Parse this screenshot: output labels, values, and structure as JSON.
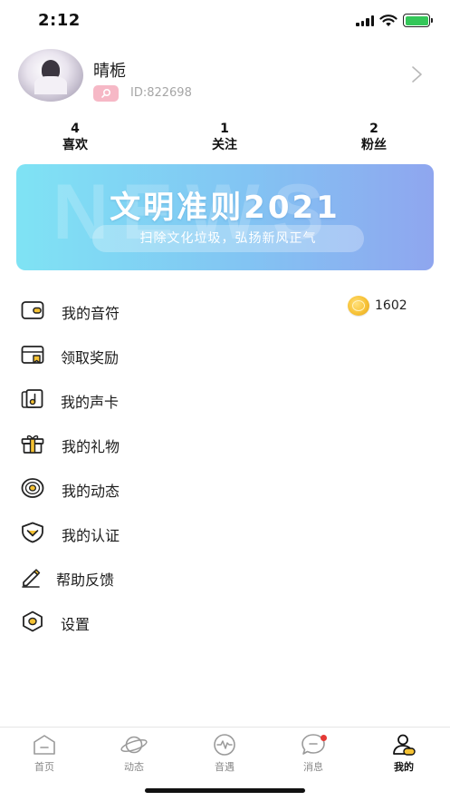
{
  "status_bar": {
    "time": "2:12"
  },
  "profile": {
    "name": "晴栀",
    "id_text": "ID:822698"
  },
  "stats": [
    {
      "count": "4",
      "label": "喜欢"
    },
    {
      "count": "1",
      "label": "关注"
    },
    {
      "count": "2",
      "label": "粉丝"
    }
  ],
  "banner": {
    "watermark": "NEWS",
    "title": "文明准则2021",
    "subtitle": "扫除文化垃圾，弘扬新风正气"
  },
  "menu": [
    {
      "label": "我的音符",
      "icon": "wallet-icon"
    },
    {
      "label": "领取奖励",
      "icon": "reward-card-icon"
    },
    {
      "label": "我的声卡",
      "icon": "sound-card-icon"
    },
    {
      "label": "我的礼物",
      "icon": "gift-icon"
    },
    {
      "label": "我的动态",
      "icon": "record-disc-icon"
    },
    {
      "label": "我的认证",
      "icon": "verified-shield-icon"
    },
    {
      "label": "帮助反馈",
      "icon": "pencil-icon"
    },
    {
      "label": "设置",
      "icon": "hexagon-settings-icon"
    }
  ],
  "coins": {
    "count": "1602"
  },
  "tabs": [
    {
      "label": "首页",
      "icon": "home-icon"
    },
    {
      "label": "动态",
      "icon": "planet-icon"
    },
    {
      "label": "音遇",
      "icon": "pulse-icon"
    },
    {
      "label": "消息",
      "icon": "chat-bubble-icon"
    },
    {
      "label": "我的",
      "icon": "user-icon"
    }
  ],
  "colors": {
    "accent": "#f5c233",
    "badge_pink": "#f6b8c6",
    "banner_start": "#7fe3f4",
    "banner_end": "#8fa6ef",
    "unread_dot": "#e53935"
  }
}
